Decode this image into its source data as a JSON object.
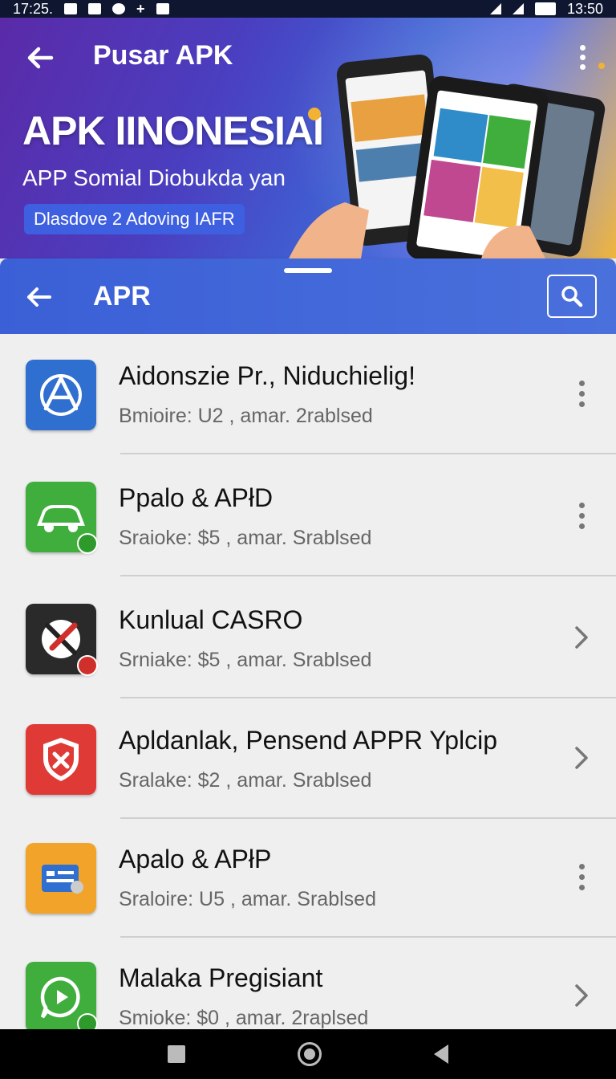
{
  "status_bar": {
    "time_left": "17:25.",
    "time_right": "13:50"
  },
  "hero": {
    "title": "Pusar APK",
    "heading": "APK IINONESIAI",
    "subtitle": "APP Somial Diobukda yan",
    "pill": "Dlasdove 2 Adoving IAFR"
  },
  "sheet": {
    "title": "APR"
  },
  "apps": [
    {
      "title": "Aidonszie Pr., Niduchielig!",
      "subtitle": "Bmioire: U2 , amar. 2rablsed",
      "action": "more",
      "icon": "app-store-icon",
      "color": "#2f6fd0"
    },
    {
      "title": "Ppalo & APłD",
      "subtitle": "Sraioke: $5 , amar. Srablsed",
      "action": "more",
      "icon": "car-icon",
      "color": "#3fae3c"
    },
    {
      "title": "Kunlual CASRO",
      "subtitle": "Srniake: $5 , amar. Srablsed",
      "action": "open",
      "icon": "tools-icon",
      "color": "#2a2a2a"
    },
    {
      "title": "Apldanlak, Pensend APPR Yplcip",
      "subtitle": "Sralake: $2 , amar. Srablsed",
      "action": "open",
      "icon": "shield-icon",
      "color": "#e03a36"
    },
    {
      "title": "Apalo & APłP",
      "subtitle": "Sraloire: U5 , amar. Srablsed",
      "action": "more",
      "icon": "id-card-icon",
      "color": "#f2a32a"
    },
    {
      "title": "Malaka Pregisiant",
      "subtitle": "Smioke: $0 , amar. 2raplsed",
      "action": "open",
      "icon": "chat-bubble-icon",
      "color": "#3fae3c"
    }
  ]
}
